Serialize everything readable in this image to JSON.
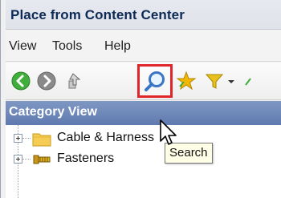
{
  "window": {
    "title": "Place from Content Center"
  },
  "menubar": {
    "items": [
      "View",
      "Tools",
      "Help"
    ]
  },
  "toolbar": {
    "buttons": [
      {
        "name": "back-icon",
        "color": "#3fae3a"
      },
      {
        "name": "forward-icon",
        "color": "#8a8a8a"
      },
      {
        "name": "up-icon"
      },
      {
        "name": "search-icon",
        "highlight_color": "#e0262b"
      },
      {
        "name": "favorites-star-icon",
        "color": "#f2b705"
      },
      {
        "name": "filter-funnel-icon",
        "color": "#e8c21a"
      }
    ]
  },
  "panel": {
    "header": "Category View"
  },
  "tree": {
    "items": [
      {
        "label": "Cable & Harness",
        "icon": "folder-icon"
      },
      {
        "label": "Fasteners",
        "icon": "fasteners-icon"
      }
    ]
  },
  "tooltip": {
    "text": "Search"
  }
}
